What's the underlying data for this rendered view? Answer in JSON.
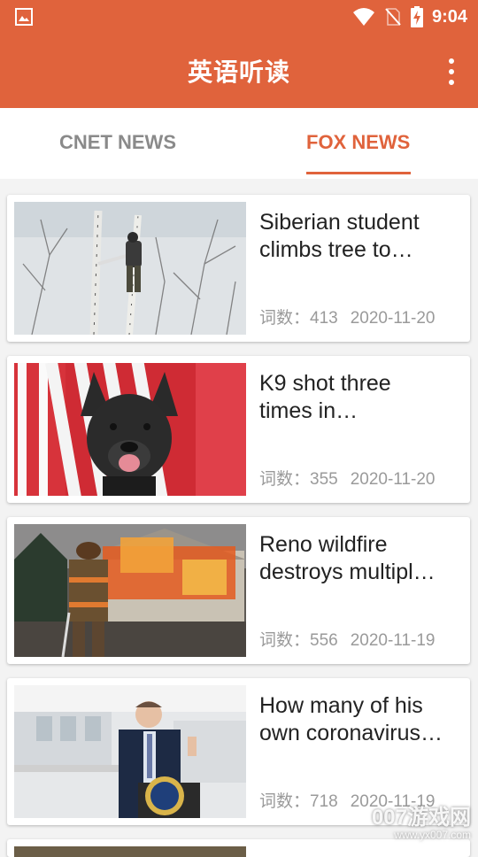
{
  "status_bar": {
    "time": "9:04"
  },
  "app_bar": {
    "title": "英语听读"
  },
  "tabs": [
    {
      "label": "CNET NEWS",
      "active": false
    },
    {
      "label": "FOX NEWS",
      "active": true
    }
  ],
  "articles": [
    {
      "title_line1": "Siberian student",
      "title_line2": "climbs tree to…",
      "word_count": "词数：413",
      "date": "2020-11-20"
    },
    {
      "title_line1": "K9 shot three",
      "title_line2": "times in…",
      "word_count": "词数：355",
      "date": "2020-11-20"
    },
    {
      "title_line1": "Reno wildfire",
      "title_line2": "destroys multipl…",
      "word_count": "词数：556",
      "date": "2020-11-19"
    },
    {
      "title_line1": "How many of his",
      "title_line2": "own coronavirus…",
      "word_count": "词数：718",
      "date": "2020-11-19"
    }
  ],
  "watermark": {
    "text": "007游戏网",
    "url": "www.yx007.com"
  },
  "colors": {
    "accent": "#e0633c",
    "inactive_tab": "#8a8a8a",
    "meta_text": "#9a9a9a"
  }
}
